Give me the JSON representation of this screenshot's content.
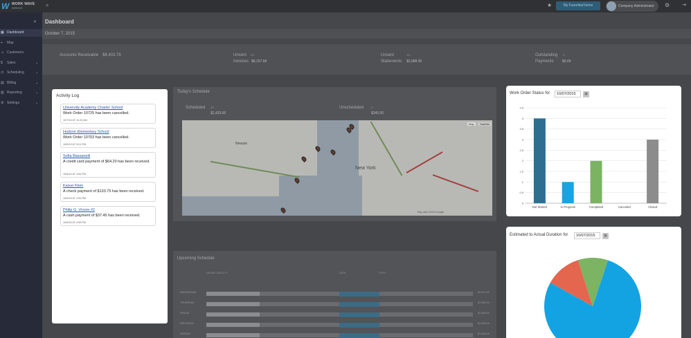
{
  "app": {
    "logo_name": "WORK WAVE",
    "logo_sub": "SERVICE"
  },
  "topbar": {
    "favorites_button": "My Favorited Items",
    "user_name": "Company Administrator"
  },
  "sidebar": {
    "items": [
      {
        "label": "Dashboard",
        "active": true,
        "has_chevron": false
      },
      {
        "label": "Map",
        "active": false,
        "has_chevron": false
      },
      {
        "label": "Customers",
        "active": false,
        "has_chevron": false
      },
      {
        "label": "Sales",
        "active": false,
        "has_chevron": true
      },
      {
        "label": "Scheduling",
        "active": false,
        "has_chevron": true
      },
      {
        "label": "Billing",
        "active": false,
        "has_chevron": true
      },
      {
        "label": "Reporting",
        "active": false,
        "has_chevron": true
      },
      {
        "label": "Settings",
        "active": false,
        "has_chevron": true
      }
    ]
  },
  "page": {
    "title": "Dashboard",
    "date": "October 7, 2015"
  },
  "summary": {
    "ar_label": "Accounts Receivable",
    "ar_value": "$8,403.78",
    "unsent_invoices_label1": "Unsent",
    "unsent_invoices_label2": "Invoices",
    "unsent_invoices_count": "34",
    "unsent_invoices_value": "$8,157.68",
    "unsent_statements_label1": "Unsent",
    "unsent_statements_label2": "Statements",
    "unsent_statements_count": "45",
    "unsent_statements_value": "$3,988.45",
    "outstanding_label1": "Outstanding",
    "outstanding_label2": "Payments",
    "outstanding_count": "0",
    "outstanding_value": "$0.00"
  },
  "activity_log": {
    "title": "Activity Log",
    "entries": [
      {
        "link": "University Academy Charter School",
        "message": "Work Order 10725 has been cancelled.",
        "time": "10/7/15 AT 11:23 AM"
      },
      {
        "link": "Hudson Elementary School",
        "message": "Work Order 10703 has been cancelled.",
        "time": "10/6/15 AT 5:01 PM"
      },
      {
        "link": "Sofia Bassanelli",
        "message": "A credit card payment of $64.20 has been received.",
        "time": "10/6/15 AT 4:59 PM"
      },
      {
        "link": "Kaiser Klein",
        "message": "A check payment of $133.75 has been received.",
        "time": "10/6/15 AT 4:59 PM"
      },
      {
        "link": "Philip G. Vroom #2",
        "message": "A cash payment of $37.45 has been received.",
        "time": "10/6/15 AT 4:58 PM"
      }
    ]
  },
  "todays_schedule": {
    "title": "Today's Schedule",
    "scheduled_label": "Scheduled",
    "scheduled_count": "10",
    "scheduled_value": "$2,433.00",
    "unscheduled_label": "Unscheduled",
    "unscheduled_count": "4",
    "unscheduled_value": "$345.00",
    "map_city_label": "New York",
    "map_newark_label": "Newark",
    "map_type_map": "Map",
    "map_type_sat": "Satellite",
    "map_footer": "Map data ©2015 Google"
  },
  "upcoming_schedule": {
    "title": "Upcoming Schedule",
    "col_capacity": "UNDER CAPACITY",
    "col_ideal": "IDEAL",
    "col_over": "OVER",
    "rows": [
      {
        "day": "WEDNESDAY",
        "amount": "$1,610.00",
        "fill": 0.2
      },
      {
        "day": "THURSDAY",
        "amount": "$1,388.00",
        "fill": 0.2
      },
      {
        "day": "FRIDAY",
        "amount": "$1,388.00",
        "fill": 0.2
      },
      {
        "day": "SATURDAY",
        "amount": "$1,388.00",
        "fill": 0.2
      },
      {
        "day": "SUNDAY",
        "amount": "$1,388.00",
        "fill": 0.2
      }
    ]
  },
  "work_order_status": {
    "title_prefix": "Work Order Status for",
    "date": "10/07/2015",
    "chart_data": {
      "type": "bar",
      "categories": [
        "Not Started",
        "In Progress",
        "Completed",
        "Canceled",
        "Closed"
      ],
      "values": [
        4,
        1,
        2,
        0,
        3
      ],
      "colors": [
        "#2e6f91",
        "#1aa3e0",
        "#7bb363",
        "#cccccc",
        "#8c8c8c"
      ],
      "ylim": [
        0,
        4.5
      ],
      "yticks": [
        "0",
        "0.5",
        "1",
        "1.5",
        "2",
        "2.5",
        "3",
        "3.5",
        "4",
        "4.5"
      ],
      "grid": true
    }
  },
  "duration": {
    "title_prefix": "Estimated to Actual Duration for",
    "date": "10/07/2015",
    "chart_data": {
      "type": "pie",
      "values": [
        0.78,
        0.12,
        0.1
      ],
      "colors": [
        "#13a3e3",
        "#e4664e",
        "#7cb463"
      ]
    }
  }
}
